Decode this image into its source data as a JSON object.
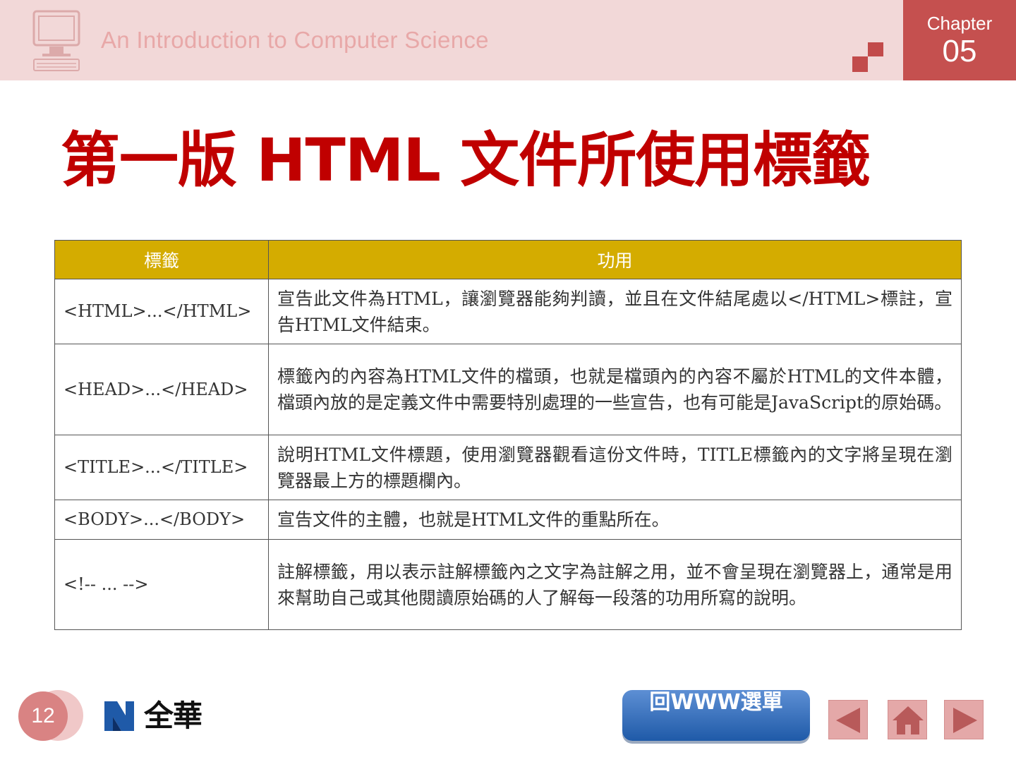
{
  "header": {
    "title": "An Introduction to Computer Science",
    "chapter_label": "Chapter",
    "chapter_number": "05"
  },
  "page_title": "第一版 HTML 文件所使用標籤",
  "table": {
    "headers": [
      "標籤",
      "功用"
    ],
    "rows": [
      {
        "tag": "<HTML>...</HTML>",
        "function": "宣告此文件為HTML，讓瀏覽器能夠判讀，並且在文件結尾處以</HTML>標註，宣告HTML文件結束。"
      },
      {
        "tag": "<HEAD>...</HEAD>",
        "function": "標籤內的內容為HTML文件的檔頭，也就是檔頭內的內容不屬於HTML的文件本體，檔頭內放的是定義文件中需要特別處理的一些宣告，也有可能是JavaScript的原始碼。"
      },
      {
        "tag": "<TITLE>...</TITLE>",
        "function": "說明HTML文件標題，使用瀏覽器觀看這份文件時，TITLE標籤內的文字將呈現在瀏覽器最上方的標題欄內。"
      },
      {
        "tag": "<BODY>...</BODY>",
        "function": "宣告文件的主體，也就是HTML文件的重點所在。"
      },
      {
        "tag": "<!-- ... -->",
        "function": "註解標籤，用以表示註解標籤內之文字為註解之用，並不會呈現在瀏覽器上，通常是用來幫助自己或其他閱讀原始碼的人了解每一段落的功用所寫的說明。"
      }
    ]
  },
  "footer": {
    "page_number": "12",
    "publisher": "全華",
    "www_button": "回WWW選單"
  },
  "colors": {
    "header_bg": "#f2d8d8",
    "chapter_bg": "#c5504f",
    "title_red": "#c00000",
    "table_header": "#d4ac00",
    "button_blue": "#1f5aa8",
    "nav_pink": "#e4a8a8"
  },
  "icons": [
    "computer-icon",
    "prev-arrow-icon",
    "home-icon",
    "next-arrow-icon",
    "publisher-logo-icon"
  ]
}
